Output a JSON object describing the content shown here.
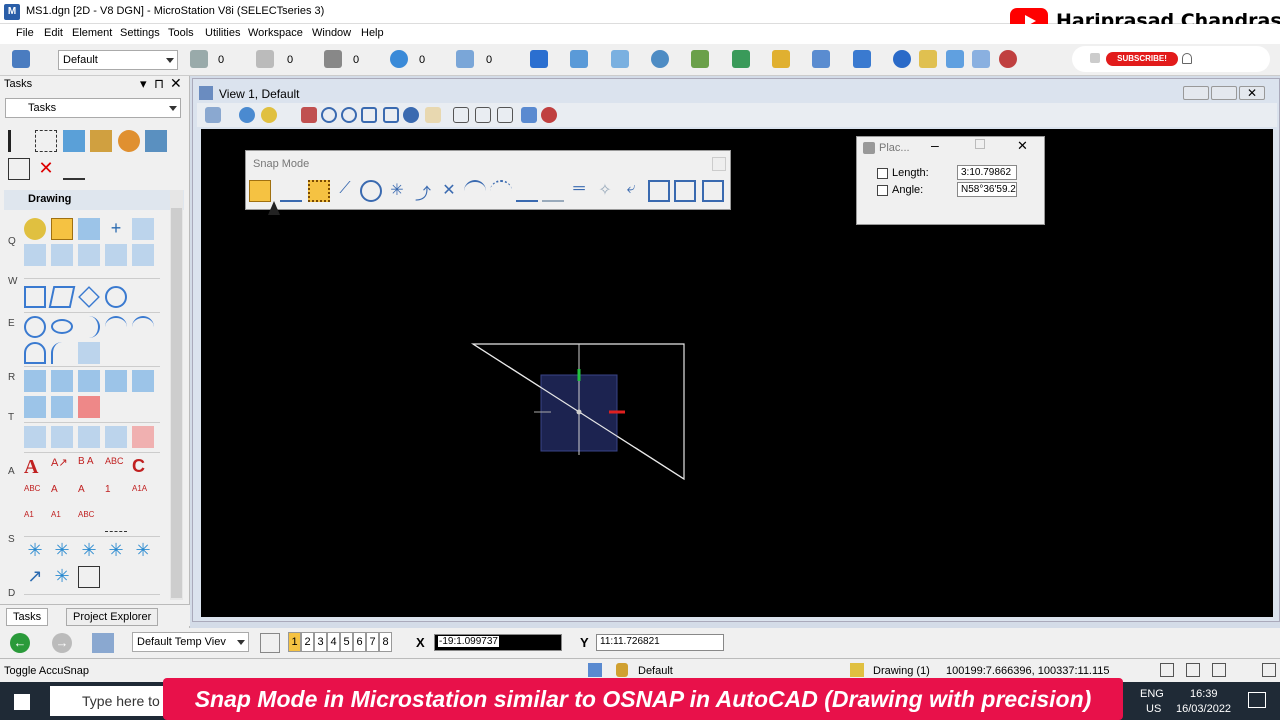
{
  "window": {
    "title": "MS1.dgn [2D - V8 DGN] - MicroStation V8i (SELECTseries 3)"
  },
  "channel": {
    "name": "Hariprasad Chandrasekar",
    "subscribe": "SUBSCRIBE!"
  },
  "menu": [
    "File",
    "Edit",
    "Element",
    "Settings",
    "Tools",
    "Utilities",
    "Workspace",
    "Window",
    "Help"
  ],
  "toolbar": {
    "level": "Default",
    "zeros": [
      "0",
      "0",
      "0",
      "0",
      "0"
    ]
  },
  "tasks": {
    "title": "Tasks",
    "dropdown": "Tasks",
    "section": "Drawing",
    "groups": [
      "Q",
      "W",
      "E",
      "R",
      "T",
      "A",
      "S",
      "D"
    ],
    "tabs": [
      "Tasks",
      "Project Explorer"
    ]
  },
  "view": {
    "title": "View 1, Default"
  },
  "snap_mode": {
    "title": "Snap Mode"
  },
  "place_line": {
    "title": "Plac...",
    "length_label": "Length:",
    "length_value": "3:10.79862",
    "angle_label": "Angle:",
    "angle_value": "N58°36'59.2"
  },
  "coords": {
    "x_label": "X",
    "x_value": "-19:1.099737",
    "y_label": "Y",
    "y_value": "11:11.726821",
    "view_combo": "Default Temp Viev",
    "view_numbers": [
      "1",
      "2",
      "3",
      "4",
      "5",
      "6",
      "7",
      "8"
    ]
  },
  "status": {
    "prompt": "Toggle AccuSnap",
    "level": "Default",
    "model": "Drawing (1)",
    "position": "100199:7.666396, 100337:11.115"
  },
  "taskbar": {
    "search_placeholder": "Type here to",
    "lang": "ENG",
    "region": "US",
    "time": "16:39",
    "date": "16/03/2022"
  },
  "caption": "Snap Mode in Microstation similar to OSNAP in AutoCAD (Drawing with precision)"
}
